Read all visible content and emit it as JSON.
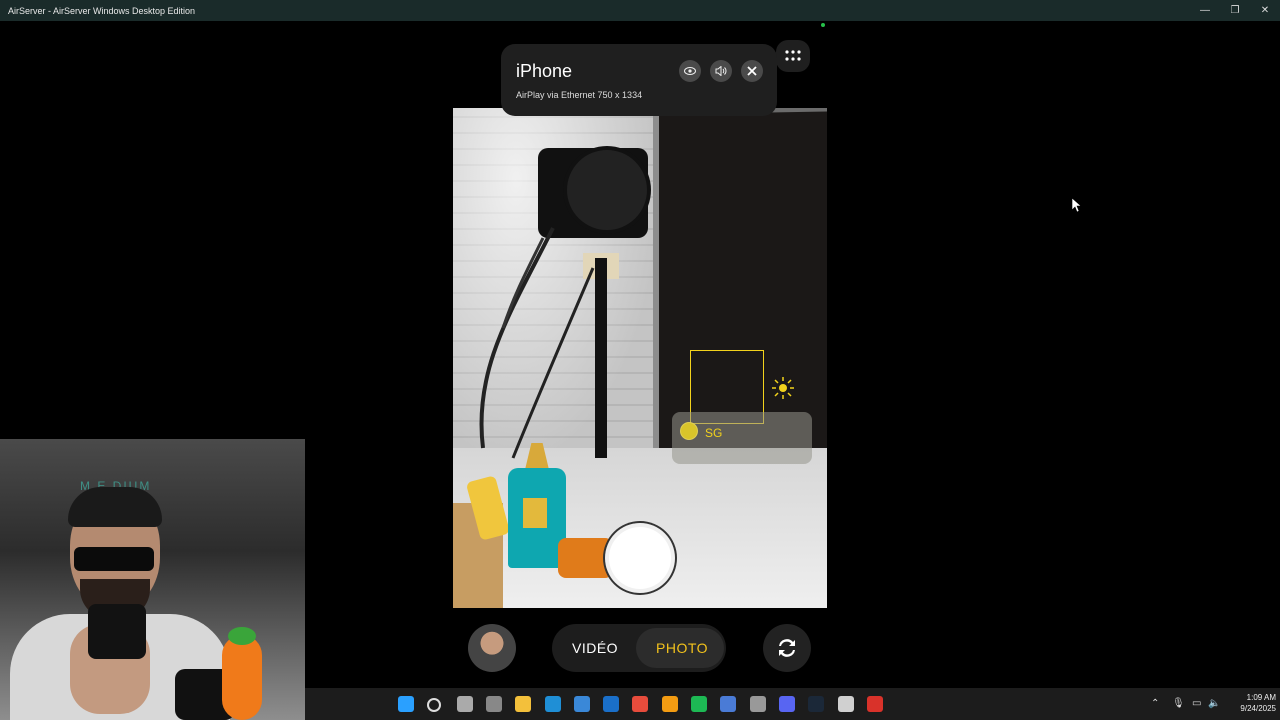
{
  "window": {
    "title": "AirServer - AirServer Windows Desktop Edition",
    "min_label": "—",
    "restore_label": "❐",
    "close_label": "✕"
  },
  "airplay": {
    "device_name": "iPhone",
    "subtitle": "AirPlay via Ethernet 750 x 1334"
  },
  "camera_ui": {
    "focus_tag": "SG",
    "mode_video": "VIDÉO",
    "mode_photo": "PHOTO",
    "accent_color": "#f2c21c"
  },
  "webcam": {
    "sign_text": "M E DIUM"
  },
  "taskbar": {
    "time": "1:09 AM",
    "date": "9/24/2025",
    "icons": [
      "windows-start-icon",
      "search-icon",
      "task-view-icon",
      "settings-icon",
      "file-explorer-icon",
      "edge-icon",
      "store-icon",
      "outlook-icon",
      "chrome-icon",
      "vlc-icon",
      "spotify-icon",
      "app-icon",
      "app2-icon",
      "discord-icon",
      "steam-icon",
      "airserver-icon",
      "app3-icon"
    ],
    "tray": [
      "chevron-up-icon",
      "mic-icon",
      "network-icon",
      "volume-icon"
    ]
  }
}
